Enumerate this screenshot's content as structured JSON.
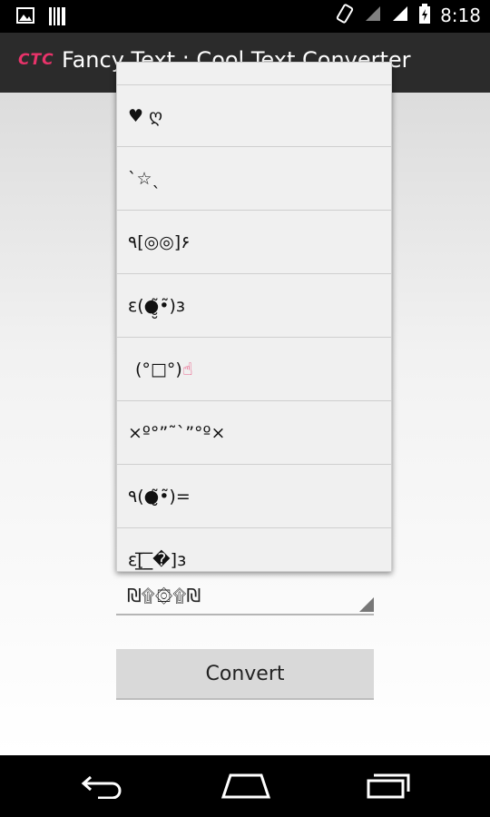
{
  "status_bar": {
    "time": "8:18",
    "icons": [
      "image-icon",
      "barcode-icon",
      "rotate-icon",
      "wifi-icon",
      "signal-icon",
      "battery-icon"
    ]
  },
  "action_bar": {
    "logo_text": "CTC",
    "title": "Fancy Text : Cool Text Converter"
  },
  "dropdown": {
    "items": [
      "♥ ღ",
      "ˋ☆ˎ",
      "٩[◎◎]۶",
      "ε(●̮̮̃•̃)з",
      "(°□°)",
      "×º°”˜`”°º×",
      "٩(●̮̮̃•̃)=",
      "ε[̲̅_̲̅�]з"
    ],
    "item5_suffix": "☝"
  },
  "spinner": {
    "selected_value": "₪۩۞۩₪"
  },
  "convert_button": {
    "label": "Convert"
  },
  "colors": {
    "accent": "#e8336a",
    "action_bar_bg": "#2b2b2b",
    "button_bg": "#d9d9d9"
  }
}
